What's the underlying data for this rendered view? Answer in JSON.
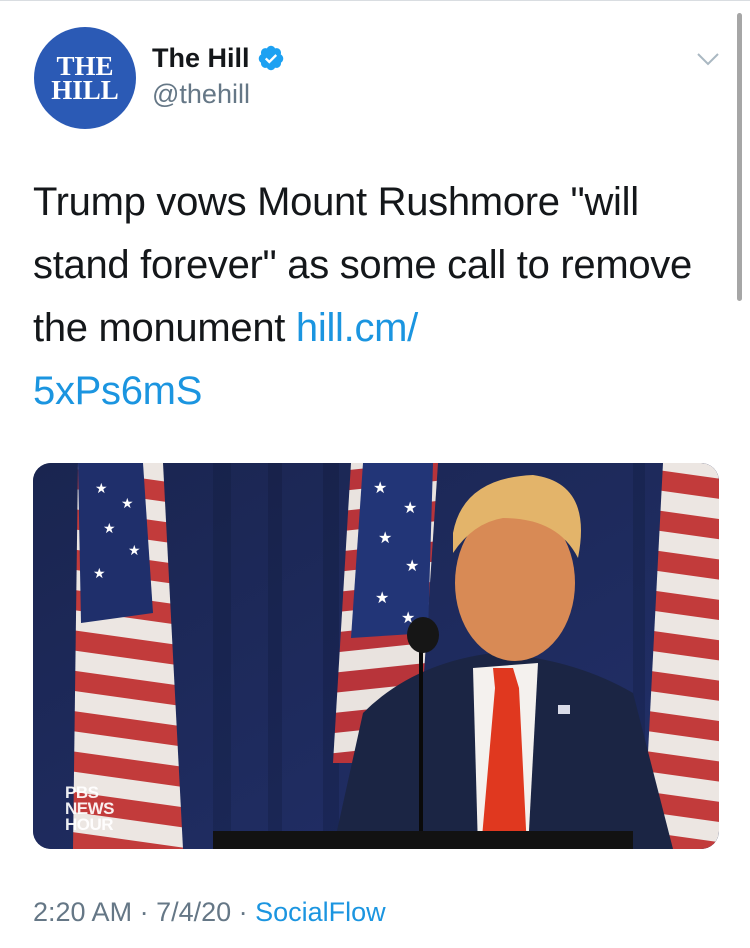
{
  "tweet": {
    "author": {
      "avatar_text_line1": "THE",
      "avatar_text_line2": "HILL",
      "display_name": "The Hill",
      "handle": "@thehill",
      "verified": true
    },
    "text_before_link": "Trump vows Mount Rushmore \"will stand forever\" as some call to remove the monument ",
    "link_line1": "hill.cm/",
    "link_line2": "5xPs6mS",
    "media": {
      "description_icon": "video-still-image",
      "watermark_line1": "PBS",
      "watermark_line2": "NEWS",
      "watermark_line3": "HOUR"
    },
    "time": "2:20 AM",
    "separator1": " · ",
    "date": "7/4/20",
    "separator2": " · ",
    "source": "SocialFlow"
  },
  "icons": {
    "verified": "verified-badge-icon",
    "caret": "chevron-down-icon"
  },
  "colors": {
    "link": "#1b95e0",
    "secondary_text": "#657786",
    "avatar_bg": "#2b5ab5",
    "verified_badge": "#1da1f2"
  }
}
